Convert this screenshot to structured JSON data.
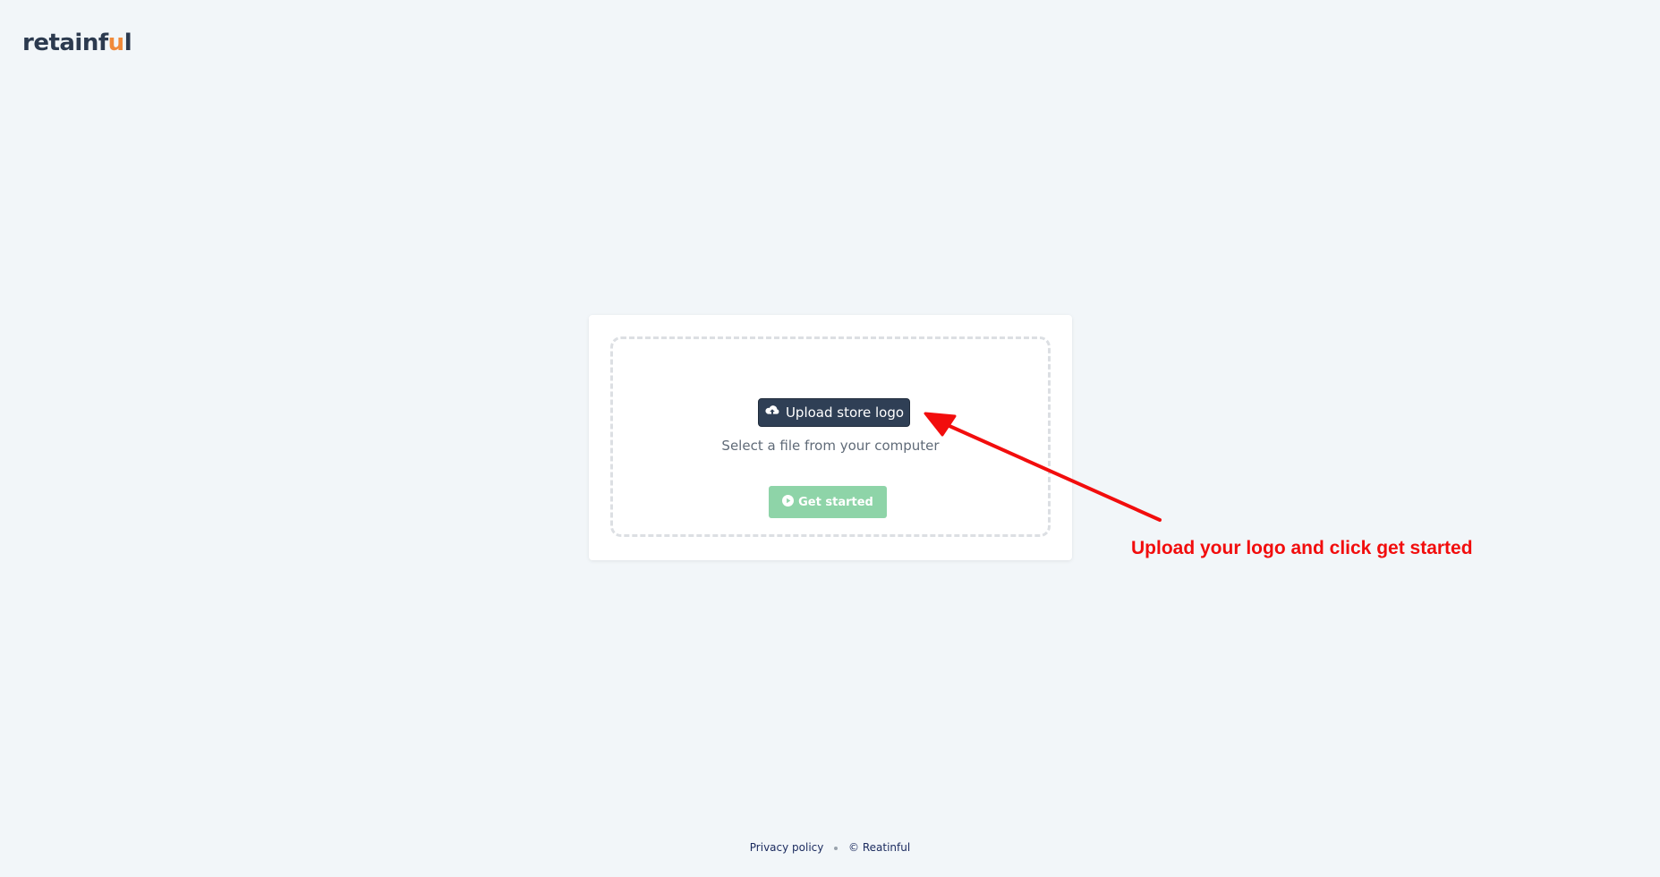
{
  "brand": {
    "logo_prefix": "retainf",
    "logo_accent": "u",
    "logo_suffix": "l",
    "accent_color": "#f08a3a"
  },
  "upload": {
    "button_label": "Upload store logo",
    "button_icon": "cloud-upload-icon",
    "hint": "Select a file from your computer"
  },
  "actions": {
    "get_started_label": "Get started",
    "get_started_icon": "play-circle-icon",
    "get_started_color": "#8ed4a8"
  },
  "annotation": {
    "text": "Upload your logo and click get started",
    "color": "#f20d0d"
  },
  "footer": {
    "privacy_label": "Privacy policy",
    "copyright": "© Reatinful"
  }
}
